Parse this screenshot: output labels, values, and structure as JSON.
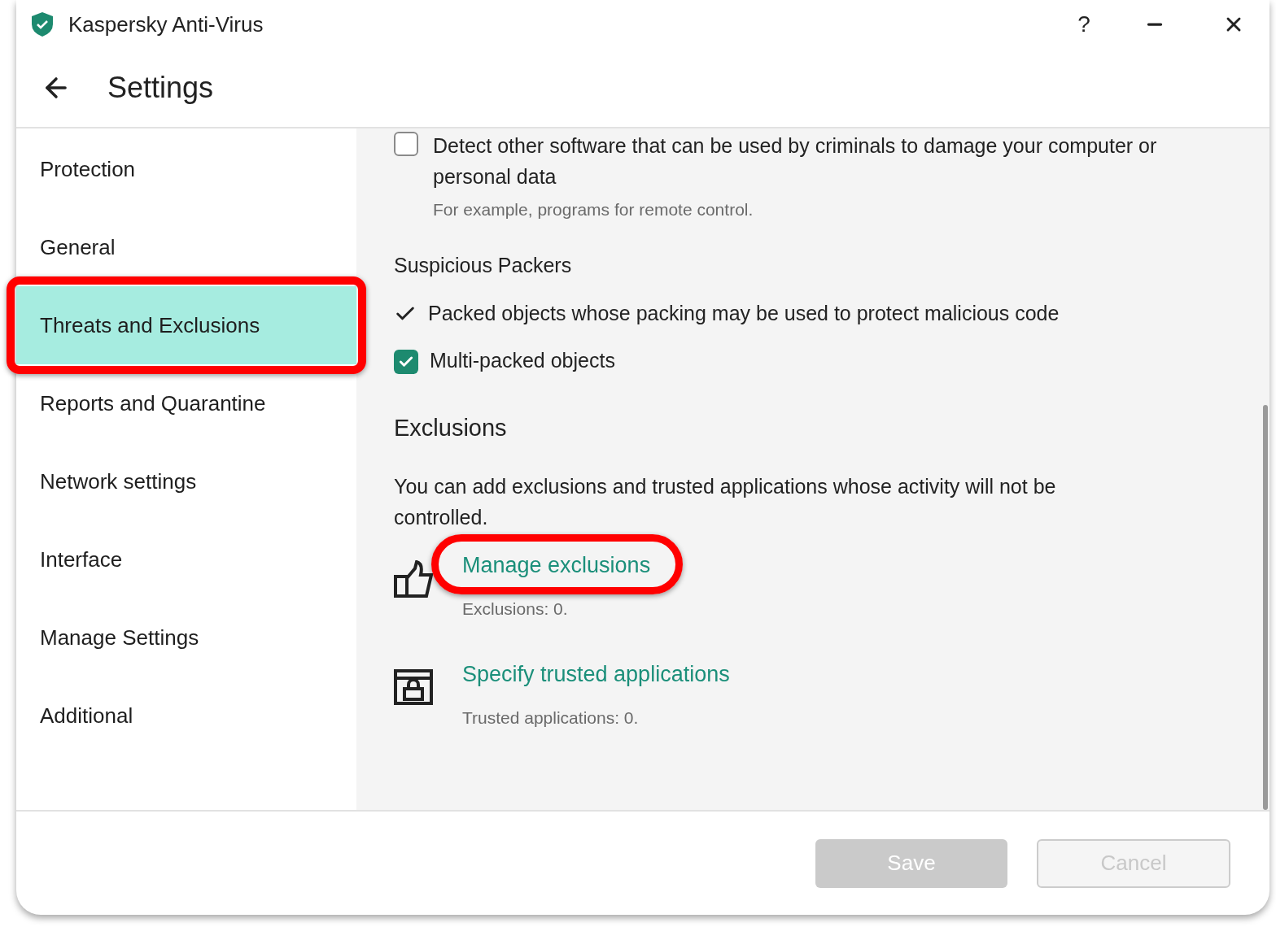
{
  "window": {
    "title": "Kaspersky Anti-Virus",
    "help": "?"
  },
  "header": {
    "title": "Settings"
  },
  "sidebar": {
    "items": [
      {
        "label": "Protection",
        "selected": false,
        "highlighted": false
      },
      {
        "label": "General",
        "selected": false,
        "highlighted": false
      },
      {
        "label": "Threats and Exclusions",
        "selected": true,
        "highlighted": true
      },
      {
        "label": "Reports and Quarantine",
        "selected": false,
        "highlighted": false
      },
      {
        "label": "Network settings",
        "selected": false,
        "highlighted": false
      },
      {
        "label": "Interface",
        "selected": false,
        "highlighted": false
      },
      {
        "label": "Manage Settings",
        "selected": false,
        "highlighted": false
      },
      {
        "label": "Additional",
        "selected": false,
        "highlighted": false
      }
    ]
  },
  "other_software": {
    "label": "Detect other software that can be used by criminals to damage your computer or personal data",
    "checked": false,
    "note": "For example, programs for remote control."
  },
  "suspicious_packers": {
    "heading": "Suspicious Packers",
    "options": [
      {
        "kind": "tick",
        "label": "Packed objects whose packing may be used to protect malicious code",
        "checked": true
      },
      {
        "kind": "checkbox",
        "label": "Multi-packed objects",
        "checked": true
      }
    ]
  },
  "exclusions": {
    "heading": "Exclusions",
    "description": "You can add exclusions and trusted applications whose activity will not be controlled.",
    "links": [
      {
        "kind": "thumb",
        "label": "Manage exclusions",
        "count": "Exclusions: 0.",
        "highlighted": true
      },
      {
        "kind": "lock",
        "label": "Specify trusted applications",
        "count": "Trusted applications: 0.",
        "highlighted": false
      }
    ]
  },
  "buttons": [
    {
      "kind": "primary",
      "label": "Save",
      "disabled": true
    },
    {
      "kind": "secondary",
      "label": "Cancel",
      "disabled": true
    }
  ]
}
